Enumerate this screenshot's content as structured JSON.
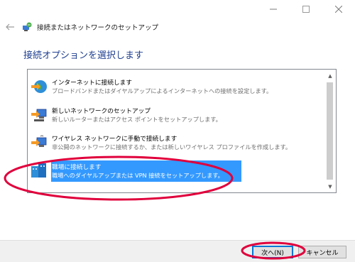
{
  "window": {
    "title": "接続またはネットワークのセットアップ",
    "controls": {
      "minimize": "minimize-icon",
      "maximize": "maximize-icon",
      "close": "close-icon"
    }
  },
  "heading": "接続オプションを選択します",
  "options": [
    {
      "icon": "internet-globe-icon",
      "title": "インターネットに接続します",
      "desc": "ブロードバンドまたはダイヤルアップによるインターネットへの接続を設定します。"
    },
    {
      "icon": "network-setup-icon",
      "title": "新しいネットワークのセットアップ",
      "desc": "新しいルーターまたはアクセス ポイントをセットアップします。"
    },
    {
      "icon": "wireless-network-icon",
      "title": "ワイヤレス ネットワークに手動で接続します",
      "desc": "非公開のネットワークに接続するか、または新しいワイヤレス プロファイルを作成します。"
    },
    {
      "icon": "workplace-icon",
      "title": "職場に接続します",
      "desc": "職場へのダイヤルアップまたは VPN 接続をセットアップします。",
      "selected": true
    }
  ],
  "buttons": {
    "next": "次へ(N)",
    "cancel": "キャンセル"
  },
  "colors": {
    "heading": "#1e3e90",
    "selection": "#3399ff",
    "annotation": "#e0003c",
    "default_button_border": "#0078d7"
  }
}
